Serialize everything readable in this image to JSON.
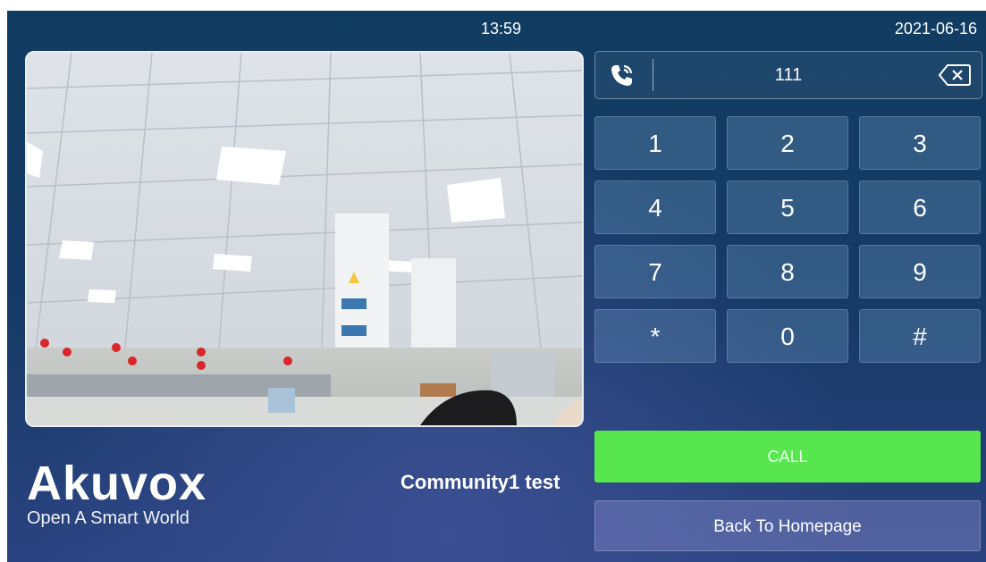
{
  "status_bar": {
    "time": "13:59",
    "date": "2021-06-16"
  },
  "camera": {
    "icon": "camera-feed-image"
  },
  "dial": {
    "number": "111",
    "phone_icon": "phone-ringing-icon",
    "backspace_icon": "backspace-icon"
  },
  "keypad": {
    "keys": [
      "1",
      "2",
      "3",
      "4",
      "5",
      "6",
      "7",
      "8",
      "9",
      "*",
      "0",
      "#"
    ]
  },
  "actions": {
    "call_label": "CALL",
    "back_label": "Back To Homepage"
  },
  "branding": {
    "logo_text": "Akuvox",
    "tagline": "Open A Smart World"
  },
  "community": {
    "name": "Community1 test"
  },
  "colors": {
    "call_green": "#57e64d",
    "background_top": "#113c62",
    "background_bottom": "#2a4381",
    "key_fill": "#4f7ea6"
  }
}
